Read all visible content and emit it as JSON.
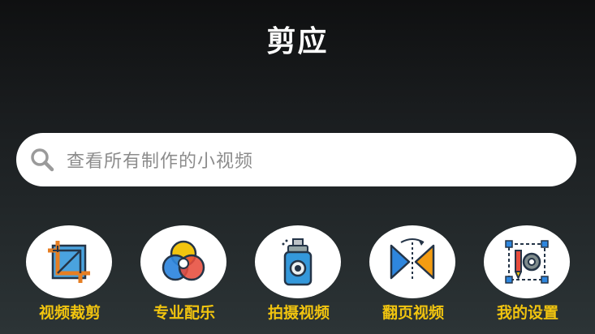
{
  "app": {
    "title": "剪应"
  },
  "search": {
    "placeholder": "查看所有制作的小视频",
    "icon": "search-icon"
  },
  "menu": {
    "items": [
      {
        "label": "视频裁剪",
        "icon": "crop-icon"
      },
      {
        "label": "专业配乐",
        "icon": "color-circles-icon"
      },
      {
        "label": "拍摄视频",
        "icon": "camera-icon"
      },
      {
        "label": "翻页视频",
        "icon": "flip-page-icon"
      },
      {
        "label": "我的设置",
        "icon": "settings-icon"
      }
    ]
  },
  "colors": {
    "background_top": "#0f1011",
    "background_bottom": "#2c3436",
    "accent_label": "#f1c40f",
    "title": "#ffffff"
  }
}
